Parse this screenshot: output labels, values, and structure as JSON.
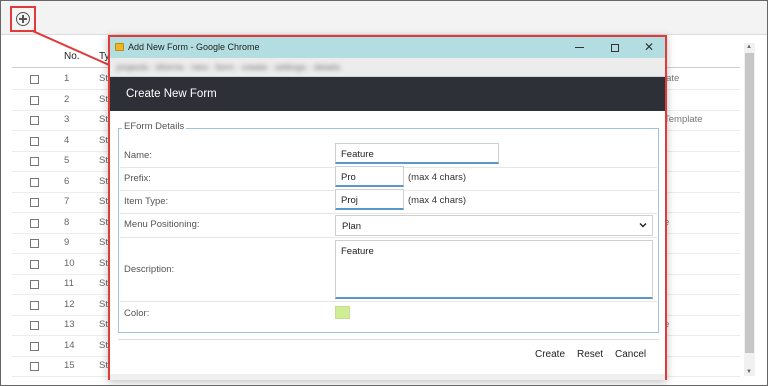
{
  "toolbar": {
    "add_icon": "plus-circle-icon"
  },
  "table": {
    "headers": {
      "no": "No.",
      "type_abbr": "Ty"
    },
    "rows": [
      {
        "no": "1",
        "abbr": "St",
        "tail": "late"
      },
      {
        "no": "2",
        "abbr": "St",
        "tail": ""
      },
      {
        "no": "3",
        "abbr": "St",
        "tail": "Template"
      },
      {
        "no": "4",
        "abbr": "St",
        "tail": ""
      },
      {
        "no": "5",
        "abbr": "St",
        "tail": ""
      },
      {
        "no": "6",
        "abbr": "St",
        "tail": ""
      },
      {
        "no": "7",
        "abbr": "St",
        "tail": ""
      },
      {
        "no": "8",
        "abbr": "St",
        "tail": "e"
      },
      {
        "no": "9",
        "abbr": "St",
        "tail": ""
      },
      {
        "no": "10",
        "abbr": "St",
        "tail": ""
      },
      {
        "no": "11",
        "abbr": "St",
        "tail": ""
      },
      {
        "no": "12",
        "abbr": "St",
        "tail": ""
      },
      {
        "no": "13",
        "abbr": "St",
        "tail": "e"
      },
      {
        "no": "14",
        "abbr": "St",
        "tail": ""
      },
      {
        "no": "15",
        "abbr": "St",
        "tail": ""
      }
    ]
  },
  "popup": {
    "window_title": "Add New Form - Google Chrome",
    "url": "p̶r̶o̶j̶e̶c̶t̶s̶ · e̶f̶o̶r̶m̶s̶ · n̶e̶w̶ · f̶o̶r̶m̶ · c̶r̶e̶a̶t̶e̶ · s̶e̶t̶t̶i̶n̶g̶s̶ · d̶e̶t̶a̶i̶l̶s̶",
    "form_title": "Create New Form",
    "section_legend": "EForm Details",
    "fields": {
      "name": {
        "label": "Name:",
        "value": "Feature"
      },
      "prefix": {
        "label": "Prefix:",
        "value": "Pro",
        "hint": "(max 4 chars)"
      },
      "item_type": {
        "label": "Item Type:",
        "value": "Proj",
        "hint": "(max 4 chars)"
      },
      "menu_positioning": {
        "label": "Menu Positioning:",
        "value": "Plan"
      },
      "description": {
        "label": "Description:",
        "value": "Feature"
      },
      "color": {
        "label": "Color:",
        "value": "#cfee93"
      }
    },
    "buttons": {
      "create": "Create",
      "reset": "Reset",
      "cancel": "Cancel"
    }
  },
  "colors": {
    "accent_red": "#e03a3a",
    "titlebar": "#b3dee1",
    "form_header": "#2d3036",
    "field_underline": "#5b97c9"
  }
}
